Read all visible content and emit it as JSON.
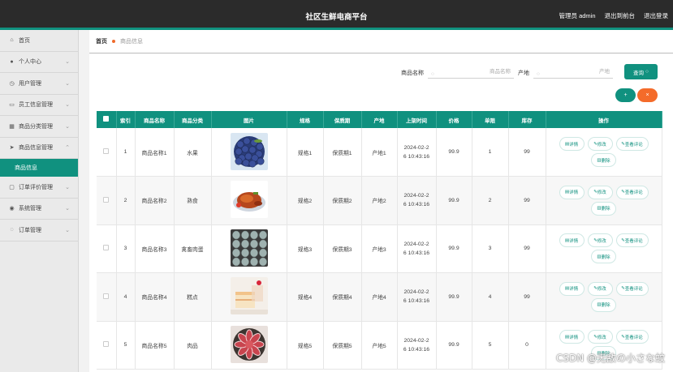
{
  "header": {
    "title": "社区生鲜电商平台",
    "user": "管理员 admin",
    "back_label": "退出到前台",
    "logout_label": "退出登录"
  },
  "sidebar": {
    "items": [
      {
        "label": "首页",
        "icon": "home-icon",
        "glyph": "⌂",
        "chev": ""
      },
      {
        "label": "个人中心",
        "icon": "user-icon",
        "glyph": "●",
        "chev": "⌄"
      },
      {
        "label": "用户管理",
        "icon": "clock-icon",
        "glyph": "◷",
        "chev": "⌄"
      },
      {
        "label": "员工信息管理",
        "icon": "monitor-icon",
        "glyph": "▭",
        "chev": "⌄"
      },
      {
        "label": "商品分类管理",
        "icon": "grid-icon",
        "glyph": "▦",
        "chev": "⌄"
      },
      {
        "label": "商品信息管理",
        "icon": "send-icon",
        "glyph": "➤",
        "chev": "⌃"
      },
      {
        "label": "订单评价管理",
        "icon": "chat-icon",
        "glyph": "▢",
        "chev": "⌄"
      },
      {
        "label": "系统管理",
        "icon": "location-icon",
        "glyph": "◉",
        "chev": "⌄"
      },
      {
        "label": "订单管理",
        "icon": "cart-icon",
        "glyph": "◌",
        "chev": "⌄"
      }
    ],
    "sub_active": "商品信息"
  },
  "breadcrumb": {
    "home": "首页",
    "current": "商品信息"
  },
  "search": {
    "name_label": "商品名称",
    "name_placeholder": "商品名称",
    "origin_label": "产地",
    "origin_placeholder": "产地",
    "query_label": "查询"
  },
  "toolbar": {
    "add_glyph": "+",
    "delete_glyph": "×"
  },
  "table": {
    "headers": [
      "",
      "索引",
      "商品名称",
      "商品分类",
      "图片",
      "规格",
      "保质期",
      "产地",
      "上架时间",
      "价格",
      "单限",
      "库存",
      "操作"
    ],
    "op_labels": {
      "detail": "详情",
      "edit": "修改",
      "review": "查看评论",
      "delete": "删除"
    },
    "rows": [
      {
        "index": "1",
        "name": "商品名称1",
        "category": "水果",
        "spec": "规格1",
        "shelf": "保质期1",
        "origin": "产地1",
        "time1": "2024-02-2",
        "time2": "6 10:43:16",
        "price": "99.9",
        "limit": "1",
        "stock": "99",
        "image": "blueberries"
      },
      {
        "index": "2",
        "name": "商品名称2",
        "category": "熟食",
        "spec": "规格2",
        "shelf": "保质期2",
        "origin": "产地2",
        "time1": "2024-02-2",
        "time2": "6 10:43:16",
        "price": "99.9",
        "limit": "2",
        "stock": "99",
        "image": "roast-chicken"
      },
      {
        "index": "3",
        "name": "商品名称3",
        "category": "禽畜肉蛋",
        "spec": "规格3",
        "shelf": "保质期3",
        "origin": "产地3",
        "time1": "2024-02-2",
        "time2": "6 10:43:16",
        "price": "99.9",
        "limit": "3",
        "stock": "99",
        "image": "eggs"
      },
      {
        "index": "4",
        "name": "商品名称4",
        "category": "糕点",
        "spec": "规格4",
        "shelf": "保质期4",
        "origin": "产地4",
        "time1": "2024-02-2",
        "time2": "6 10:43:16",
        "price": "99.9",
        "limit": "4",
        "stock": "99",
        "image": "cake"
      },
      {
        "index": "5",
        "name": "商品名称5",
        "category": "肉品",
        "spec": "规格5",
        "shelf": "保质期5",
        "origin": "产地5",
        "time1": "2024-02-2",
        "time2": "6 10:43:16",
        "price": "99.9",
        "limit": "5",
        "stock": "0",
        "image": "meat-slices"
      }
    ]
  },
  "watermark": "CSDN @无敌の小さな蚊",
  "colors": {
    "primary": "#10917f",
    "danger": "#f46b2a",
    "topbar": "#2b2b2b"
  }
}
